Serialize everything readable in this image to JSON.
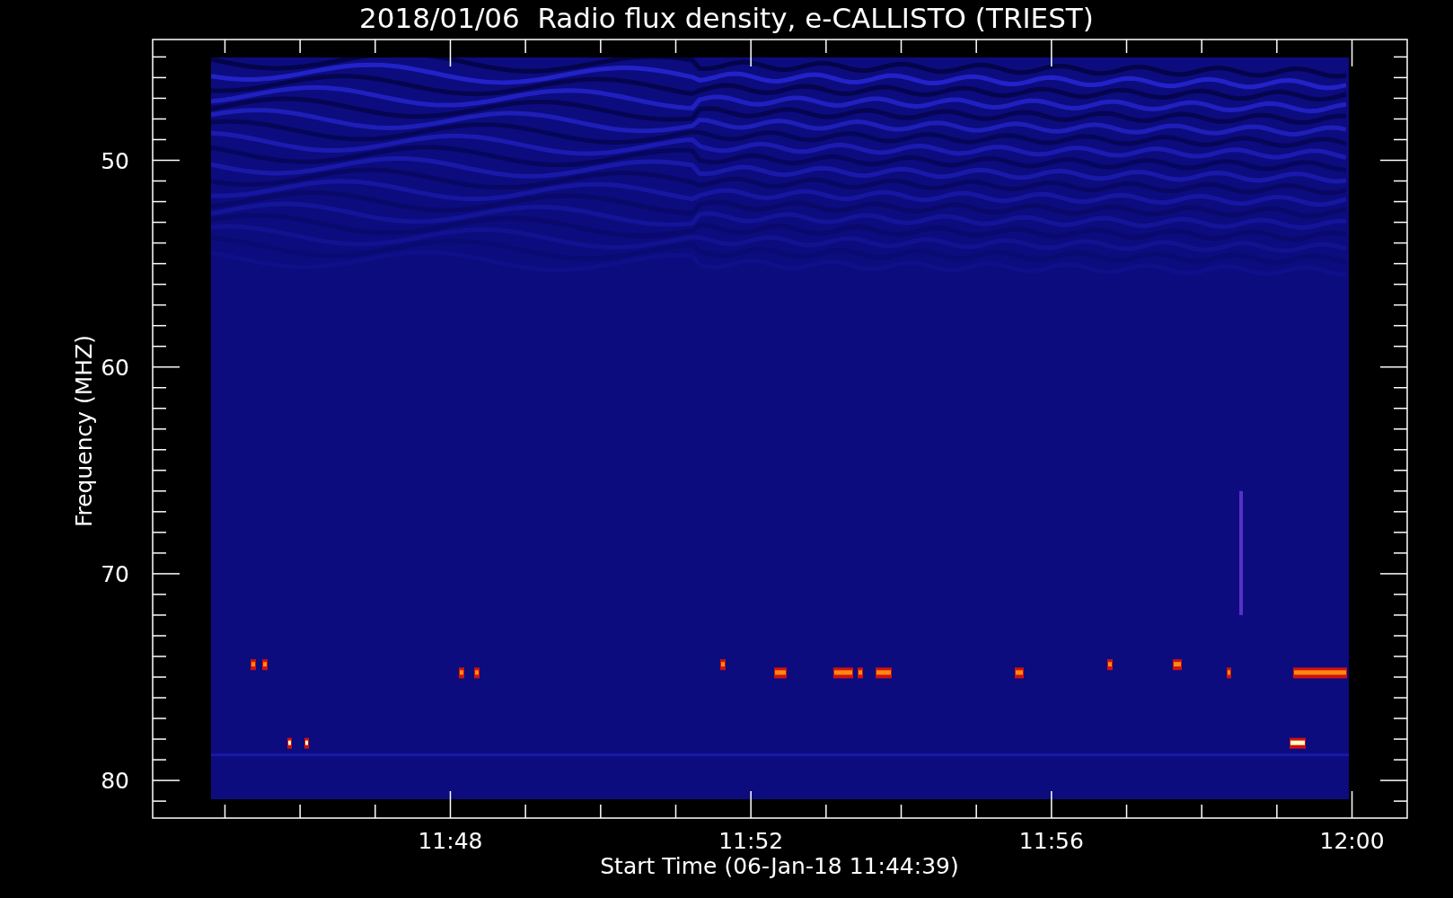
{
  "title": "2018/01/06  Radio flux density, e-CALLISTO (TRIEST)",
  "plot": {
    "ylabel": "Frequency (MHZ)",
    "xlabel": "Start Time (06-Jan-18 11:44:39)",
    "yticks": [
      "50",
      "60",
      "70",
      "80"
    ],
    "xticks": [
      "11:48",
      "11:52",
      "11:56",
      "12:00"
    ]
  }
}
